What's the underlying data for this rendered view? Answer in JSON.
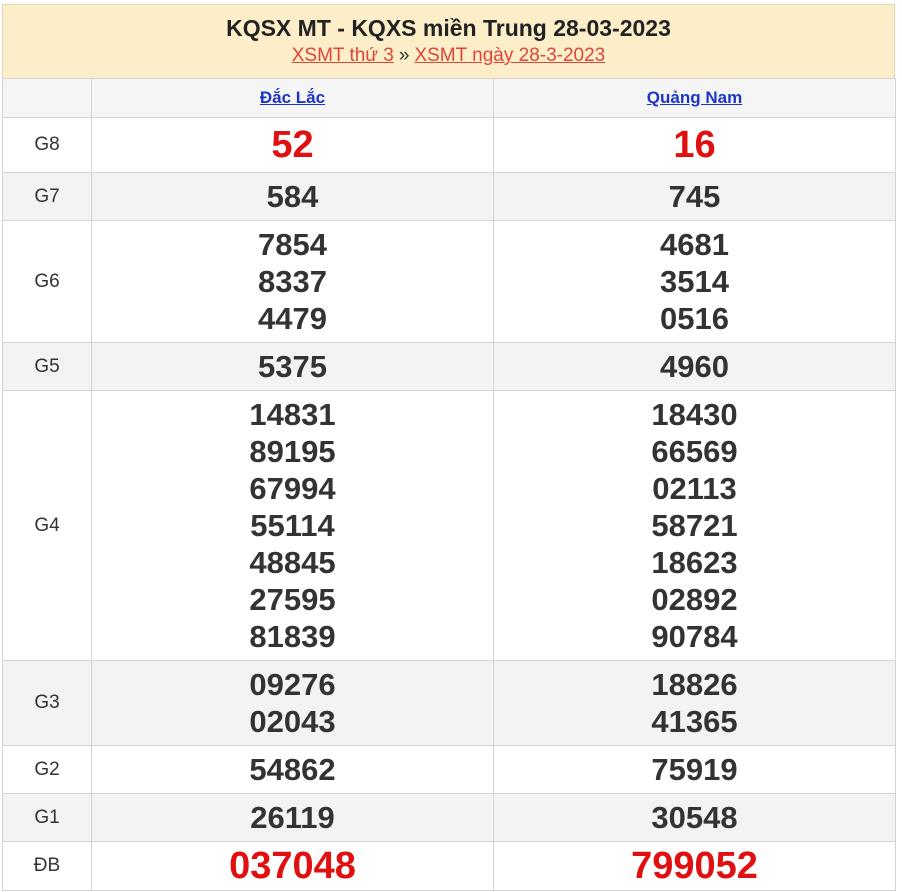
{
  "header": {
    "title": "KQSX MT - KQXS miền Trung 28-03-2023",
    "link1": "XSMT thứ 3",
    "separator": "»",
    "link2": "XSMT ngày 28-3-2023"
  },
  "provinces": [
    "Đắc Lắc",
    "Quảng Nam"
  ],
  "prizes": [
    {
      "label": "G8",
      "values": [
        [
          "52"
        ],
        [
          "16"
        ]
      ]
    },
    {
      "label": "G7",
      "values": [
        [
          "584"
        ],
        [
          "745"
        ]
      ]
    },
    {
      "label": "G6",
      "values": [
        [
          "7854",
          "8337",
          "4479"
        ],
        [
          "4681",
          "3514",
          "0516"
        ]
      ]
    },
    {
      "label": "G5",
      "values": [
        [
          "5375"
        ],
        [
          "4960"
        ]
      ]
    },
    {
      "label": "G4",
      "values": [
        [
          "14831",
          "89195",
          "67994",
          "55114",
          "48845",
          "27595",
          "81839"
        ],
        [
          "18430",
          "66569",
          "02113",
          "58721",
          "18623",
          "02892",
          "90784"
        ]
      ]
    },
    {
      "label": "G3",
      "values": [
        [
          "09276",
          "02043"
        ],
        [
          "18826",
          "41365"
        ]
      ]
    },
    {
      "label": "G2",
      "values": [
        [
          "54862"
        ],
        [
          "75919"
        ]
      ]
    },
    {
      "label": "G1",
      "values": [
        [
          "26119"
        ],
        [
          "30548"
        ]
      ]
    },
    {
      "label": "ĐB",
      "values": [
        [
          "037048"
        ],
        [
          "799052"
        ]
      ]
    }
  ],
  "colors": {
    "header_bg": "#fbeec8",
    "link": "#e0453a",
    "province_link": "#1b36c6",
    "highlight": "#e10f0f"
  }
}
